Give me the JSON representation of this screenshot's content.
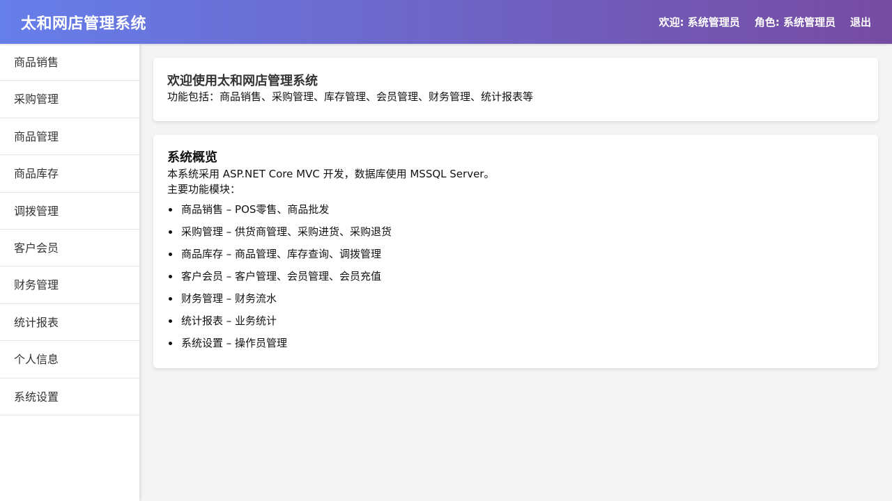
{
  "header": {
    "title": "太和网店管理系统",
    "welcome": "欢迎: 系统管理员",
    "role": "角色: 系统管理员",
    "logout": "退出"
  },
  "sidebar": {
    "items": [
      {
        "label": "商品销售"
      },
      {
        "label": "采购管理"
      },
      {
        "label": "商品管理"
      },
      {
        "label": "商品库存"
      },
      {
        "label": "调拨管理"
      },
      {
        "label": "客户会员"
      },
      {
        "label": "财务管理"
      },
      {
        "label": "统计报表"
      },
      {
        "label": "个人信息"
      },
      {
        "label": "系统设置"
      }
    ]
  },
  "welcome_card": {
    "title": "欢迎使用太和网店管理系统",
    "text": "功能包括：商品销售、采购管理、库存管理、会员管理、财务管理、统计报表等"
  },
  "overview_card": {
    "title": "系统概览",
    "description": "本系统采用 ASP.NET Core MVC 开发，数据库使用 MSSQL Server。",
    "modules_heading": "主要功能模块：",
    "modules": [
      "商品销售 – POS零售、商品批发",
      "采购管理 – 供货商管理、采购进货、采购退货",
      "商品库存 – 商品管理、库存查询、调拨管理",
      "客户会员 – 客户管理、会员管理、会员充值",
      "财务管理 – 财务流水",
      "统计报表 – 业务统计",
      "系统设置 – 操作员管理"
    ]
  },
  "colors": {
    "header_gradient_start": "#667eea",
    "header_gradient_end": "#764ba2",
    "background": "#f4f4f4"
  }
}
